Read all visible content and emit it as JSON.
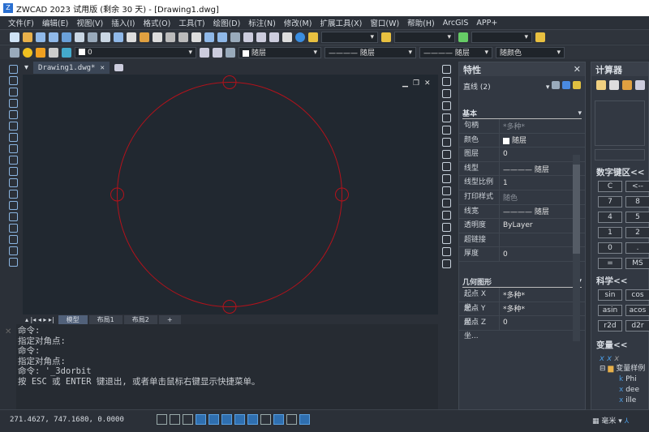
{
  "title": "ZWCAD 2023 试用版 (剩余 30 天) - [Drawing1.dwg]",
  "menu": [
    "文件(F)",
    "编辑(E)",
    "视图(V)",
    "插入(I)",
    "格式(O)",
    "工具(T)",
    "绘图(D)",
    "标注(N)",
    "修改(M)",
    "扩展工具(X)",
    "窗口(W)",
    "帮助(H)",
    "ArcGIS",
    "APP+"
  ],
  "toolbar": {
    "layer_value": "0",
    "color_value": "随层",
    "linetype_value": "随层",
    "lineweight_value": "随层",
    "plotstyle_value": "随颜色"
  },
  "doc_tab": "Drawing1.dwg*",
  "layout_tabs": [
    "模型",
    "布局1",
    "布局2",
    "+"
  ],
  "command_lines": [
    "命令:",
    "指定对角点:",
    "命令:",
    "指定对角点:",
    "命令: '_3dorbit",
    "按 ESC 或 ENTER 键退出, 或者单击鼠标右键显示快捷菜单。"
  ],
  "status": {
    "coords": "271.4627, 747.1680, 0.0000",
    "units": "毫米"
  },
  "properties": {
    "title": "特性",
    "selection": "直线 (2)",
    "basic_title": "基本",
    "basic": [
      [
        "句柄",
        "*多种*"
      ],
      [
        "颜色",
        "随层"
      ],
      [
        "图层",
        "0"
      ],
      [
        "线型",
        "———— 随层"
      ],
      [
        "线型比例",
        "1"
      ],
      [
        "打印样式",
        "随色"
      ],
      [
        "线宽",
        "———— 随层"
      ],
      [
        "透明度",
        "ByLayer"
      ],
      [
        "超链接",
        ""
      ],
      [
        "厚度",
        "0"
      ]
    ],
    "geom_title": "几何图形",
    "geom": [
      [
        "起点 X 坐...",
        "*多种*"
      ],
      [
        "起点 Y 坐...",
        "*多种*"
      ],
      [
        "起点 Z 坐...",
        "0"
      ]
    ]
  },
  "calculator": {
    "title": "计算器",
    "numpad_title": "数字键区<<",
    "numpad": [
      "C",
      "<--",
      "7",
      "8",
      "4",
      "5",
      "1",
      "2",
      "0",
      ".",
      "=",
      "MS"
    ],
    "sci_title": "科学<<",
    "sci": [
      "sin",
      "cos",
      "asin",
      "acos",
      "r2d",
      "d2r"
    ],
    "var_title": "变量<<",
    "var_group": "变量样例",
    "vars": [
      "Phi",
      "dee",
      "ille"
    ]
  },
  "colors": {
    "circle": "#b3121b",
    "canvas": "#212830",
    "accent": "#2f6fb0"
  }
}
